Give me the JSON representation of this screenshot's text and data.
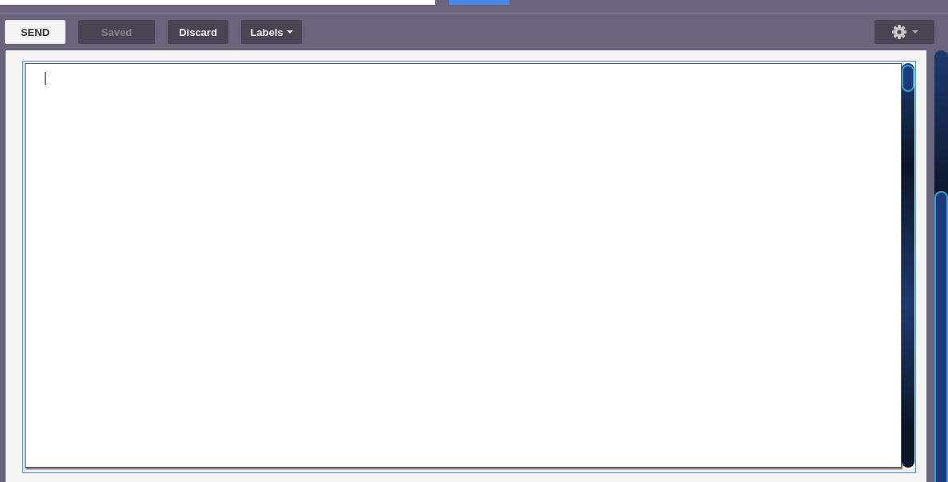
{
  "toolbar": {
    "buttons": [
      {
        "label": "SEND",
        "kind": "primary",
        "disabled": false
      },
      {
        "label": "Saved",
        "kind": "dark",
        "disabled": true
      },
      {
        "label": "Discard",
        "kind": "dark",
        "disabled": false
      },
      {
        "label": "Labels",
        "kind": "menu",
        "disabled": false
      }
    ]
  }
}
